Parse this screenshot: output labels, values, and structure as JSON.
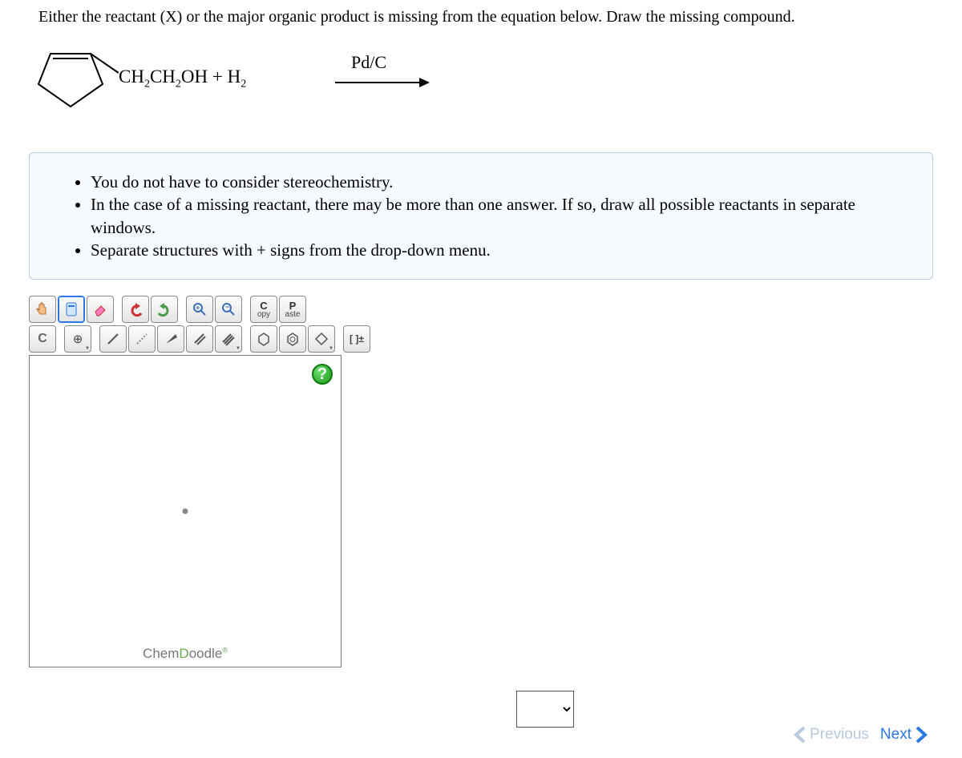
{
  "question": "Either the reactant (X) or the major organic product is missing from the equation below. Draw the missing compound.",
  "equation": {
    "side_chain_html": "CH<sub>2</sub>CH<sub>2</sub>OH  +  H<sub>2</sub>",
    "catalyst": "Pd/C"
  },
  "hints": [
    "You do not have to consider stereochemistry.",
    "In the case of a missing reactant, there may be more than one answer. If so, draw all possible reactants in separate windows.",
    "Separate structures with + signs from the drop-down menu."
  ],
  "toolbar": {
    "hand": "✋",
    "lasso": "⬚",
    "erase": "◨",
    "undo": "↶",
    "redo": "↷",
    "zoom_in": "+",
    "zoom_out": "−",
    "copy_top": "C",
    "copy_bottom": "opy",
    "paste_top": "P",
    "paste_bottom": "aste",
    "carbon": "C",
    "add": "⊕",
    "single": "/",
    "recessed": "⋰",
    "wedge": "◢",
    "double": "//",
    "triple": "///",
    "ring1": "○",
    "ring2": "◎",
    "ring3": "⬡",
    "charge": "[ ]±"
  },
  "help": "?",
  "logo_text": "ChemDoodle",
  "nav": {
    "previous": "Previous",
    "next": "Next"
  }
}
